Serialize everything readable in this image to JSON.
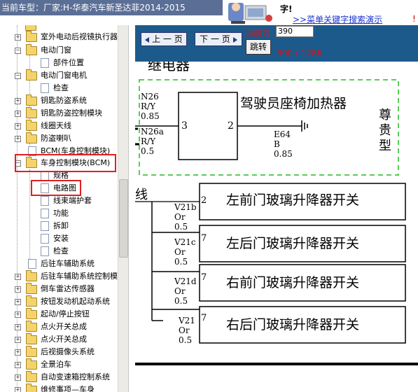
{
  "header": {
    "title": "当前车型：厂家:H-华泰汽车新圣达菲2014-2015",
    "hint": "字!",
    "search_link": ">>菜单关键字搜索演示",
    "excl": "!"
  },
  "sidebar": {
    "items": [
      {
        "label": "室外电动后视镜执行器"
      },
      {
        "label": "电动门窗"
      },
      {
        "label": "部件位置"
      },
      {
        "label": "电动门窗电机"
      },
      {
        "label": "检查"
      },
      {
        "label": "钥匙防盗系统"
      },
      {
        "label": "钥匙防盗控制模块"
      },
      {
        "label": "线圈天线"
      },
      {
        "label": "防盗喇叭"
      },
      {
        "label": "BCM(车身控制模块)"
      },
      {
        "label": "车身控制模块(BCM)"
      },
      {
        "label": "规格"
      },
      {
        "label": "电路图"
      },
      {
        "label": "线束端护套"
      },
      {
        "label": "功能"
      },
      {
        "label": "拆卸"
      },
      {
        "label": "安装"
      },
      {
        "label": "检查"
      },
      {
        "label": "后驻车辅助系统"
      },
      {
        "label": "后驻车辅助系统控制模"
      },
      {
        "label": "倒车雷达传感器"
      },
      {
        "label": "按钮发动机起动系统"
      },
      {
        "label": "起动/停止按钮"
      },
      {
        "label": "点火开关总成"
      },
      {
        "label": "点火开关总成"
      },
      {
        "label": "后视摄像头系统"
      },
      {
        "label": "全景泊车"
      },
      {
        "label": "自动变速箱控制系统"
      },
      {
        "label": "维修事项—车身"
      }
    ]
  },
  "nav": {
    "prev_label": "上 一 页",
    "next_label": "下 一 页",
    "current_label": "当前为",
    "page_value": "390",
    "jump_label": "跳转",
    "page_count": "390 / 1286"
  },
  "diagram": {
    "heading": "继电器",
    "heater": {
      "wire_left": [
        "N26",
        "R/Y",
        "0.85"
      ],
      "wire_left2": [
        "N26a",
        "R/Y",
        "0.5"
      ],
      "pin_left": "3",
      "pin_right": "2",
      "name": "驾驶员座椅加热器",
      "wire_right": [
        "E64",
        "B",
        "0.85"
      ],
      "trim": [
        "尊",
        "贵",
        "型"
      ]
    },
    "line_label": "线",
    "switches": [
      {
        "wire": [
          "V21b",
          "Or",
          "0.5"
        ],
        "pin": "2",
        "name": "左前门玻璃升降器开关"
      },
      {
        "wire": [
          "V21c",
          "Or",
          "0.5"
        ],
        "pin": "7",
        "name": "左后门玻璃升降器开关"
      },
      {
        "wire": [
          "V21d",
          "Or",
          "0.5"
        ],
        "pin": "7",
        "name": "右前门玻璃升降器开关"
      },
      {
        "wire": [
          "V21",
          "Or",
          "0.5"
        ],
        "pin": "7",
        "name": "右后门玻璃升降器开关"
      }
    ]
  },
  "colors": {
    "title_bar": "#5b6f96",
    "nav_bar": "#1d5a8c",
    "highlight": "#e02020",
    "dashed_box": "#22bb22",
    "page_text": "#e21010"
  }
}
